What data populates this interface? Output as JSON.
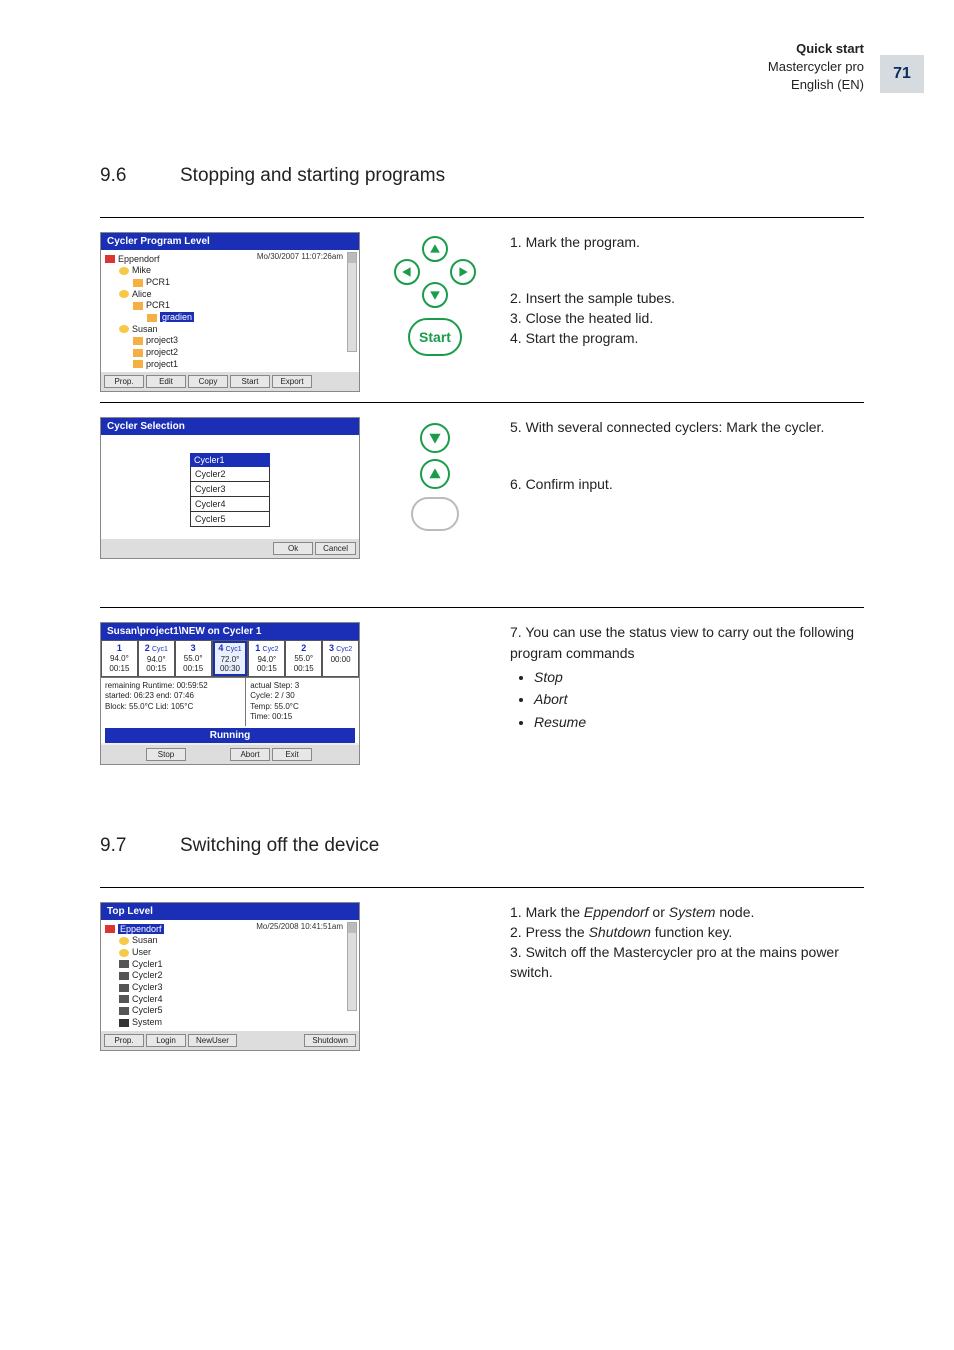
{
  "header": {
    "quick_start": "Quick start",
    "product": "Mastercycler pro",
    "lang": "English (EN)",
    "page_number": "71"
  },
  "sections": {
    "s96": {
      "num": "9.6",
      "title": "Stopping and starting programs"
    },
    "s97": {
      "num": "9.7",
      "title": "Switching off the device"
    }
  },
  "instructions": {
    "s96_a1": "1. Mark the program.",
    "s96_a2": "2. Insert the sample tubes.",
    "s96_a3": "3. Close the heated lid.",
    "s96_a4": "4. Start the program.",
    "s96_b1": "5. With several connected cyclers: Mark the cycler.",
    "s96_b2": "6. Confirm input.",
    "s96_c1": "7. You can use the status view to carry out the following program commands",
    "s96_c_items": {
      "i0": "Stop",
      "i1": "Abort",
      "i2": "Resume"
    },
    "s97_1_pre": "1. Mark the ",
    "s97_1_epp": "Eppendorf",
    "s97_1_mid": " or ",
    "s97_1_sys": "System",
    "s97_1_post": " node.",
    "s97_2_pre": "2. Press the ",
    "s97_2_btn": "Shutdown",
    "s97_2_post": " function key.",
    "s97_3": "3. Switch off the Mastercycler pro at the mains power switch."
  },
  "buttons": {
    "start": "Start"
  },
  "screenshots": {
    "program_level": {
      "title": "Cycler Program Level",
      "timestamp": "Mo/30/2007 11:07:26am",
      "root": "Eppendorf",
      "users": {
        "u0": "Mike",
        "u1": "Alice",
        "u2": "Susan"
      },
      "mike_pcr1": "PCR1",
      "alice_pcr1": "PCR1",
      "gradient": "gradien",
      "susan_p3": "project3",
      "susan_p2": "project2",
      "susan_p1": "project1",
      "footer": {
        "b0": "Prop.",
        "b1": "Edit",
        "b2": "Copy",
        "b3": "Start",
        "b4": "Export"
      }
    },
    "cycler_selection": {
      "title": "Cycler Selection",
      "head": "Cycler1",
      "c2": "Cycler2",
      "c3": "Cycler3",
      "c4": "Cycler4",
      "c5": "Cycler5",
      "footer": {
        "ok": "Ok",
        "cancel": "Cancel"
      }
    },
    "status": {
      "title": "Susan\\project1\\NEW  on Cycler 1",
      "steps": {
        "s1": {
          "n": "1",
          "cyc": "",
          "t": "94.0°",
          "d": "00:15"
        },
        "s2": {
          "n": "2",
          "cyc": "Cyc1",
          "t": "94.0°",
          "d": "00:15"
        },
        "s3": {
          "n": "3",
          "cyc": "",
          "t": "55.0°",
          "d": "00:15"
        },
        "s4": {
          "n": "4",
          "cyc": "Cyc1",
          "t": "72.0°",
          "d": "00:30"
        },
        "s5": {
          "n": "1",
          "cyc": "Cyc2",
          "t": "94.0°",
          "d": "00:15"
        },
        "s6": {
          "n": "2",
          "cyc": "",
          "t": "55.0°",
          "d": "00:15"
        },
        "s7": {
          "n": "3",
          "cyc": "Cyc2",
          "t": "",
          "d": "00:00"
        }
      },
      "info_left": {
        "l1": "remaining Runtime: 00:59:52",
        "l2": "started: 06:23    end: 07:46",
        "l3": "Block: 55.0°C   Lid: 105°C"
      },
      "info_right": {
        "r1": "actual Step:   3",
        "r2": "Cycle:        2 / 30",
        "r3": "Temp:        55.0°C",
        "r4": "Time:         00:15"
      },
      "running": "Running",
      "footer": {
        "stop": "Stop",
        "abort": "Abort",
        "exit": "Exit"
      }
    },
    "top_level": {
      "title": "Top Level",
      "timestamp": "Mo/25/2008 10:41:51am",
      "root": "Eppendorf",
      "susan": "Susan",
      "user": "User",
      "c1": "Cycler1",
      "c2": "Cycler2",
      "c3": "Cycler3",
      "c4": "Cycler4",
      "c5": "Cycler5",
      "system": "System",
      "footer": {
        "prop": "Prop.",
        "login": "Login",
        "newuser": "NewUser",
        "shutdown": "Shutdown"
      }
    }
  }
}
